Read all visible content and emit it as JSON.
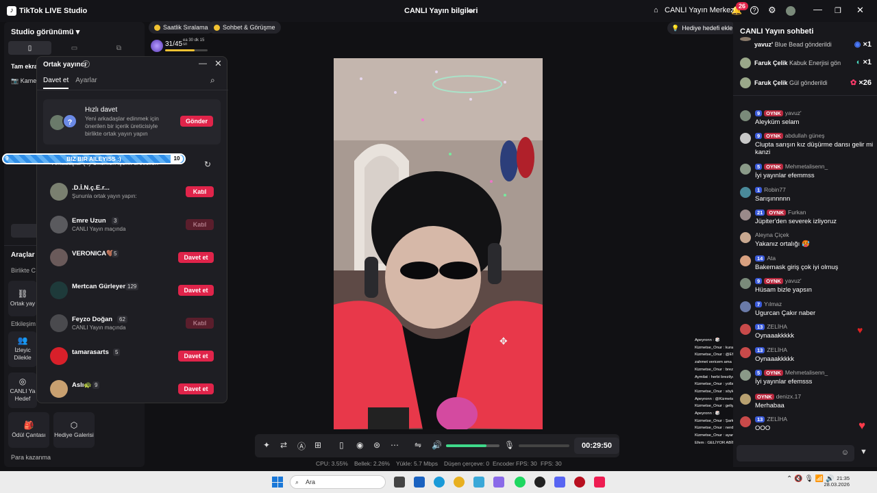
{
  "titlebar": {
    "app_title": "TikTok LIVE Studio",
    "center_title": "CANLI Yayın bilgileri",
    "live_center": "CANLI Yayın Merkezi",
    "notif_count": "26"
  },
  "left": {
    "studio_view": "Studio görünümü",
    "fullscreen": "Tam ekra",
    "camera": "Kame",
    "tools": "Araçlar",
    "birlikte": "Birlikte C",
    "cohost_tile": "Ortak yay",
    "etkilesim": "Etkileşim",
    "izleyici": "İzleyic Dilekle",
    "canli_hedef": "CANLI Ya Hedef",
    "odul": "Ödül Çantası",
    "hediye_galeri": "Hediye Galerisi",
    "para": "Para kazanma"
  },
  "chips": {
    "saatlik": "Saatlik Sıralama",
    "sohbet": "Sohbet & Görüşme"
  },
  "level": {
    "value": "31/45",
    "time": "ea 30 dk 15 sn",
    "progress": 0.7
  },
  "popup": {
    "title": "Ortak yayıncı",
    "tab_invite": "Davet et",
    "tab_settings": "Ayarlar",
    "quick_title": "Hızlı davet",
    "quick_desc": "Yeni arkadaşlar edinmek için önerilen bir içerik üreticisiyle birlikte ortak yayın yapın",
    "quick_btn": "Gönder",
    "under_tabs": "Arkadaşlar (4)   Önerilen içerik üreticileri",
    "people": [
      {
        "name": ".D.İ.N.ç.E.r...",
        "count": "",
        "sub": "Şununla ortak yayın yapın:",
        "btn": "Katıl",
        "disabled": false
      },
      {
        "name": "Emre Uzun",
        "count": "3",
        "sub": "CANLI Yayın maçında",
        "btn": "Katıl",
        "disabled": true
      },
      {
        "name": "VERONICA🤎",
        "count": "5",
        "sub": "",
        "btn": "Davet et",
        "disabled": false
      },
      {
        "name": "Mertcan Gürleyen",
        "count": "129",
        "sub": "",
        "btn": "Davet et",
        "disabled": false
      },
      {
        "name": "Feyzo Doğan",
        "count": "62",
        "sub": "CANLI Yayın maçında",
        "btn": "Katıl",
        "disabled": true
      },
      {
        "name": "tamarasarts",
        "count": "5",
        "sub": "",
        "btn": "Davet et",
        "disabled": false
      },
      {
        "name": "Aslı🐢",
        "count": "9",
        "sub": "",
        "btn": "Davet et",
        "disabled": false
      }
    ]
  },
  "banner": {
    "left": "9",
    "label": "BIZ BIR AILEYISS :)",
    "right": "10"
  },
  "goal": "Hediye hedefi ekle",
  "controls": {
    "timer": "00:29:50",
    "volume": 0.75
  },
  "stats": {
    "cpu": "CPU: 3.55%",
    "mem": "Bellek: 2.26%",
    "upload": "Yükle: 5.7 Mbps",
    "dropped": "Düşen çerçeve: 0",
    "encoder": "Encoder FPS: 30",
    "fps": "FPS: 30"
  },
  "chat": {
    "title": "CANLI Yayın sohbeti",
    "gifts": [
      {
        "user": "yavuz'",
        "text": "Blue Bead gönderildi",
        "mult": "×1"
      },
      {
        "user": "Faruk Çelik",
        "text": "Kabuk Enerjisi gön",
        "mult": "×1"
      },
      {
        "user": "Faruk Çelik",
        "text": "Gül gönderildi",
        "mult": "×26"
      }
    ],
    "messages": [
      {
        "lvl": "9",
        "fan": "OYNK",
        "user": "yavuz'",
        "text": "Aleyküm selam"
      },
      {
        "lvl": "9",
        "fan": "OYNK",
        "user": "abdullah güneş",
        "text": "Clupta sarışın kız düşürme dansı gelir mi kanzi"
      },
      {
        "lvl": "5",
        "fan": "OYNK",
        "user": "Mehmetalisenn_",
        "text": "İyi yayınlar efemmss"
      },
      {
        "lvl": "1",
        "fan": "",
        "user": "Robin77",
        "text": "Sarışınnnnn"
      },
      {
        "lvl": "21",
        "fan": "OYNK",
        "user": "Furkan",
        "text": "Jüpiter'den severek izliyoruz"
      },
      {
        "lvl": "",
        "fan": "",
        "user": "Aleyna Çiçek",
        "text": "Yakanız ortalığı 🥵"
      },
      {
        "lvl": "14",
        "fan": "",
        "user": "Ata",
        "text": "Bakemask giriş çok iyi olmuş"
      },
      {
        "lvl": "9",
        "fan": "OYNK",
        "user": "yavuz'",
        "text": "Hüsam bizle yapsın"
      },
      {
        "lvl": "7",
        "fan": "",
        "user": "Yılmaz",
        "text": "Ugurcan Çakır naber"
      },
      {
        "lvl": "13",
        "fan": "",
        "user": "ZELİHA",
        "text": "Oynaaakkkkk"
      },
      {
        "lvl": "13",
        "fan": "",
        "user": "ZELİHA",
        "text": "Oynaaakkkkk"
      },
      {
        "lvl": "5",
        "fan": "OYNK",
        "user": "Mehmetalisenn_",
        "text": "İyi yayınlar efemsss"
      },
      {
        "lvl": "",
        "fan": "OYNK",
        "user": "denizx.17",
        "text": "Merhabaa"
      },
      {
        "lvl": "13",
        "fan": "",
        "user": "ZELİHA",
        "text": "OOO"
      }
    ]
  },
  "overlay": [
    "Apeyronn : 🎲",
    "Kizmetse_Onur : kurabiyece",
    "Kizmetse_Onur : @Efem dc ödedim ablam sarkıyı efeye söyler misin efem",
    "zahmet vericem ama",
    "Kizmetse_Onur : brezilyan öztek",
    "Aymilat : herbi brezilyan özlerdi",
    "Kizmetse_Onur : yolladım acarsa",
    "Kizmetse_Onur : söyle yar",
    "Apeyronn : @Kizmetse_Onur da elbette brezilyan tadı demeğersezde😄",
    "Kizmetse_Onur : geliyor geliyorrr",
    "Apeyronn : 🎲",
    "Kizmetse_Onur : Şarkı var solda :D",
    "Kizmetse_Onur : nerdesin iki gözümün ciceği hasan",
    "Kizmetse_Onur : ayar lazım ya",
    "Efem : GELİYOR ABİM O DA İŞTEN CIKICAK 10 GİBİ"
  ],
  "taskbar": {
    "search": "Ara",
    "time": "21:35",
    "date": "28.03.2026"
  },
  "colors": {
    "accent": "#e0244a",
    "volume": "#3fd98a"
  }
}
